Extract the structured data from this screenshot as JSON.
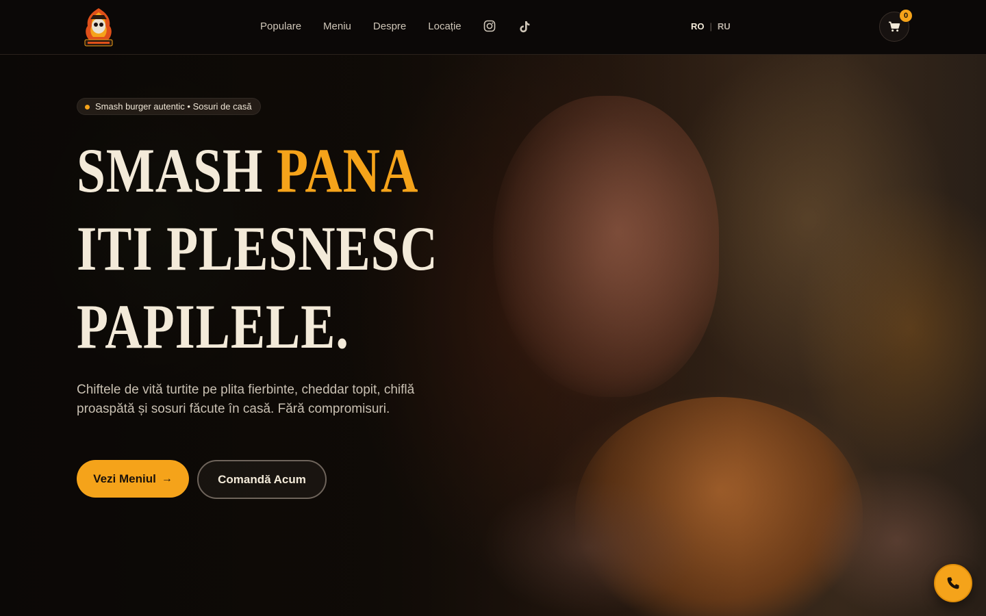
{
  "header": {
    "logo_alt": "Bandito Smash Burger",
    "nav": [
      {
        "label": "Populare"
      },
      {
        "label": "Meniu"
      },
      {
        "label": "Despre"
      },
      {
        "label": "Locație"
      }
    ],
    "social_icons": [
      "instagram-icon",
      "tiktok-icon"
    ],
    "lang": {
      "active": "RO",
      "separator": "|",
      "other": "RU"
    },
    "cart": {
      "icon": "cart-icon",
      "count": "0"
    }
  },
  "hero": {
    "tag": "Smash burger autentic • Sosuri de casă",
    "headline": {
      "line1_a": "SMASH ",
      "line1_b": "PANA",
      "line2": "ITI PLESNESC",
      "line3": "PAPILELE."
    },
    "subtitle": "Chiftele de vită turtite pe plita fierbinte, cheddar topit, chiflă proaspătă și sosuri făcute în casă. Fără compromisuri.",
    "primary_button": {
      "label": "Vezi Meniul",
      "arrow": "→"
    },
    "secondary_button": {
      "label": "Comandă Acum"
    }
  },
  "floating": {
    "phone_icon": "phone-icon"
  },
  "colors": {
    "accent": "#f5a31a",
    "text": "#f3ead9",
    "header_bg": "#0b0807"
  }
}
